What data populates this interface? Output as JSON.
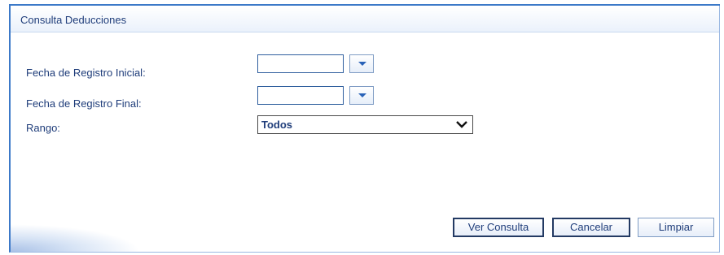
{
  "panel": {
    "title": "Consulta Deducciones"
  },
  "form": {
    "fecha_inicial_label": "Fecha de Registro Inicial:",
    "fecha_inicial_value": "",
    "fecha_final_label": "Fecha de Registro Final:",
    "fecha_final_value": "",
    "rango_label": "Rango:",
    "rango_selected": "Todos"
  },
  "actions": {
    "ver_consulta": "Ver Consulta",
    "cancelar": "Cancelar",
    "limpiar": "Limpiar"
  },
  "icons": {
    "date_dropdown": "triangle-down-icon",
    "select_arrow": "chevron-down-icon"
  },
  "colors": {
    "accent": "#3c79c8",
    "label_text": "#1f3d7a"
  }
}
